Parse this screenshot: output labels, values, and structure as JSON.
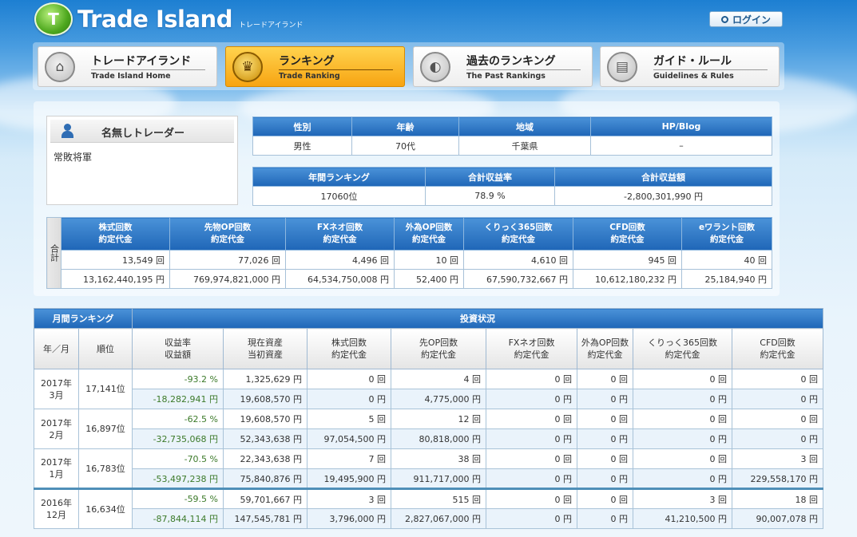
{
  "header": {
    "logo_mark": "T",
    "logo_title": "Trade Island",
    "logo_sub": "トレードアイランド",
    "login_label": "ログイン"
  },
  "nav": [
    {
      "label": "トレードアイランド",
      "sub": "Trade Island Home",
      "icon": "home-icon",
      "active": false
    },
    {
      "label": "ランキング",
      "sub": "Trade Ranking",
      "icon": "crown-icon",
      "active": true
    },
    {
      "label": "過去のランキング",
      "sub": "The Past Rankings",
      "icon": "history-book-icon",
      "active": false
    },
    {
      "label": "ガイド・ルール",
      "sub": "Guidelines & Rules",
      "icon": "open-book-icon",
      "active": false
    }
  ],
  "user": {
    "name": "名無しトレーダー",
    "comment": "常敗将軍"
  },
  "profile": {
    "headers": [
      "性別",
      "年齢",
      "地域",
      "HP/Blog"
    ],
    "values": [
      "男性",
      "70代",
      "千葉県",
      "–"
    ]
  },
  "summary": {
    "headers": [
      "年間ランキング",
      "合計収益率",
      "合計収益額"
    ],
    "values": [
      "17060位",
      "78.9 %",
      "-2,800,301,990 円"
    ]
  },
  "totals": {
    "side_label": "合計",
    "headers": [
      [
        "株式回数",
        "約定代金"
      ],
      [
        "先物OP回数",
        "約定代金"
      ],
      [
        "FXネオ回数",
        "約定代金"
      ],
      [
        "外為OP回数",
        "約定代金"
      ],
      [
        "くりっく365回数",
        "約定代金"
      ],
      [
        "CFD回数",
        "約定代金"
      ],
      [
        "eワラント回数",
        "約定代金"
      ]
    ],
    "counts": [
      "13,549 回",
      "77,026 回",
      "4,496 回",
      "10 回",
      "4,610 回",
      "945 回",
      "40 回"
    ],
    "amounts": [
      "13,162,440,195 円",
      "769,974,821,000 円",
      "64,534,750,008 円",
      "52,400 円",
      "67,590,732,667 円",
      "10,612,180,232 円",
      "25,184,940 円"
    ]
  },
  "monthly": {
    "title": "月間ランキング",
    "section_title": "投資状況",
    "columns": [
      [
        "年／月"
      ],
      [
        "順位"
      ],
      [
        "収益率",
        "収益額"
      ],
      [
        "現在資産",
        "当初資産"
      ],
      [
        "株式回数",
        "約定代金"
      ],
      [
        "先OP回数",
        "約定代金"
      ],
      [
        "FXネオ回数",
        "約定代金"
      ],
      [
        "外為OP回数",
        "約定代金"
      ],
      [
        "くりっく365回数",
        "約定代金"
      ],
      [
        "CFD回数",
        "約定代金"
      ]
    ],
    "rows": [
      {
        "year": "2017年",
        "month": "3月",
        "rank": "17,141位",
        "top": [
          "-93.2 %",
          "1,325,629 円",
          "0 回",
          "4 回",
          "0 回",
          "0 回",
          "0 回",
          "0 回"
        ],
        "bottom": [
          "-18,282,941 円",
          "19,608,570 円",
          "0 円",
          "4,775,000 円",
          "0 円",
          "0 円",
          "0 円",
          "0 円"
        ]
      },
      {
        "year": "2017年",
        "month": "2月",
        "rank": "16,897位",
        "top": [
          "-62.5 %",
          "19,608,570 円",
          "5 回",
          "12 回",
          "0 回",
          "0 回",
          "0 回",
          "0 回"
        ],
        "bottom": [
          "-32,735,068 円",
          "52,343,638 円",
          "97,054,500 円",
          "80,818,000 円",
          "0 円",
          "0 円",
          "0 円",
          "0 円"
        ]
      },
      {
        "year": "2017年",
        "month": "1月",
        "rank": "16,783位",
        "top": [
          "-70.5 %",
          "22,343,638 円",
          "7 回",
          "38 回",
          "0 回",
          "0 回",
          "0 回",
          "3 回"
        ],
        "bottom": [
          "-53,497,238 円",
          "75,840,876 円",
          "19,495,900 円",
          "911,717,000 円",
          "0 円",
          "0 円",
          "0 円",
          "229,558,170 円"
        ]
      },
      {
        "year": "2016年",
        "month": "12月",
        "rank": "16,634位",
        "top": [
          "-59.5 %",
          "59,701,667 円",
          "3 回",
          "515 回",
          "0 回",
          "0 回",
          "3 回",
          "18 回"
        ],
        "bottom": [
          "-87,844,114 円",
          "147,545,781 円",
          "3,796,000 円",
          "2,827,067,000 円",
          "0 円",
          "0 円",
          "41,210,500 円",
          "90,007,078 円"
        ]
      }
    ]
  },
  "colors": {
    "header_blue": "#1f66b7",
    "active_tab": "#f7a412",
    "positive_rate_green": "#3c7a2a"
  }
}
